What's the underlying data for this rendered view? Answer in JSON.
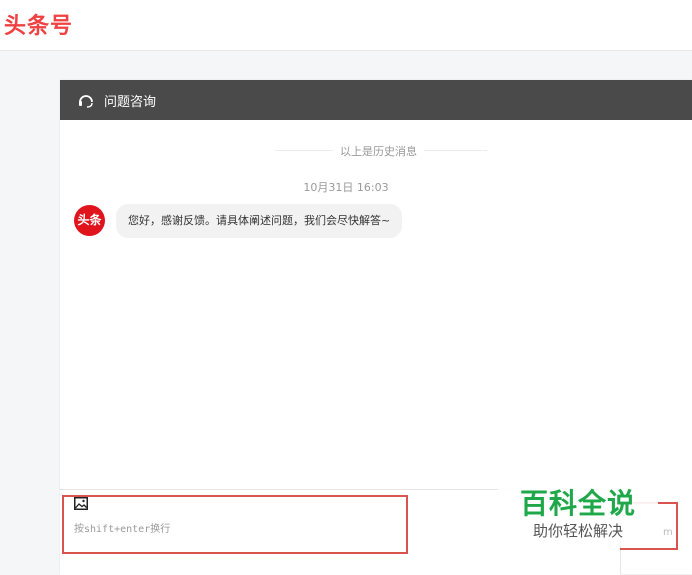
{
  "brand": {
    "logo_text": "头条号",
    "color": "#f04142"
  },
  "panel": {
    "header_title": "问题咨询",
    "header_icon": "headset-icon",
    "header_bg": "#4a4a4a"
  },
  "chat": {
    "history_divider": "以上是历史消息",
    "timestamp": "10月31日 16:03",
    "messages": [
      {
        "sender_avatar_text": "头条",
        "text": "您好，感谢反馈。请具体阐述问题，我们会尽快解答~"
      }
    ]
  },
  "composer": {
    "image_icon": "image-icon",
    "placeholder": "按shift+enter换行"
  },
  "right_panel": {
    "partial_text": "m"
  },
  "watermark": {
    "title": "百科全说",
    "subtitle": "助你轻松解决",
    "color": "#1ea84a"
  },
  "highlight_color": "#d9534f"
}
